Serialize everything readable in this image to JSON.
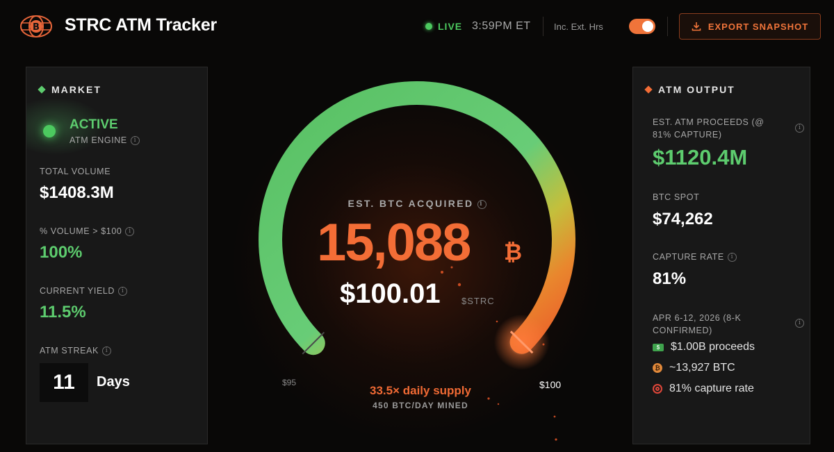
{
  "header": {
    "title": "STRC ATM Tracker",
    "live_label": "LIVE",
    "time": "3:59PM ET",
    "ext_hours_label": "Inc. Ext. Hrs",
    "ext_hours_enabled": true,
    "export_label": "EXPORT SNAPSHOT"
  },
  "market": {
    "title": "MARKET",
    "status": "ACTIVE",
    "engine_label": "ATM ENGINE",
    "total_volume_label": "TOTAL VOLUME",
    "total_volume": "$1408.3M",
    "pct_volume_label": "% VOLUME > $100",
    "pct_volume": "100%",
    "yield_label": "CURRENT YIELD",
    "yield": "11.5%",
    "streak_label": "ATM STREAK",
    "streak_value": "11",
    "streak_unit": "Days"
  },
  "center": {
    "btc_label": "EST. BTC ACQUIRED",
    "btc_value": "15,088",
    "btc_symbol": "₿",
    "price": "$100.01",
    "ticker": "$STRC",
    "min_label": "$95",
    "max_label": "$100",
    "gauge_fraction": 0.998,
    "supply_text": "33.5× daily supply",
    "mined_text": "450 BTC/DAY MINED"
  },
  "atm": {
    "title": "ATM OUTPUT",
    "proceeds_label": "EST. ATM PROCEEDS (@ 81% CAPTURE)",
    "proceeds": "$1120.4M",
    "spot_label": "BTC SPOT",
    "spot": "$74,262",
    "capture_label": "CAPTURE RATE",
    "capture": "81%",
    "period_label": "APR 6-12, 2026 (8-K CONFIRMED)",
    "items": [
      {
        "icon": "cash-icon",
        "text": "$1.00B proceeds"
      },
      {
        "icon": "bitcoin-icon",
        "text": "~13,927 BTC"
      },
      {
        "icon": "target-icon",
        "text": "81% capture rate"
      }
    ]
  },
  "colors": {
    "accent": "#f36d36",
    "green": "#5dcc6e",
    "live": "#4cc95f"
  }
}
